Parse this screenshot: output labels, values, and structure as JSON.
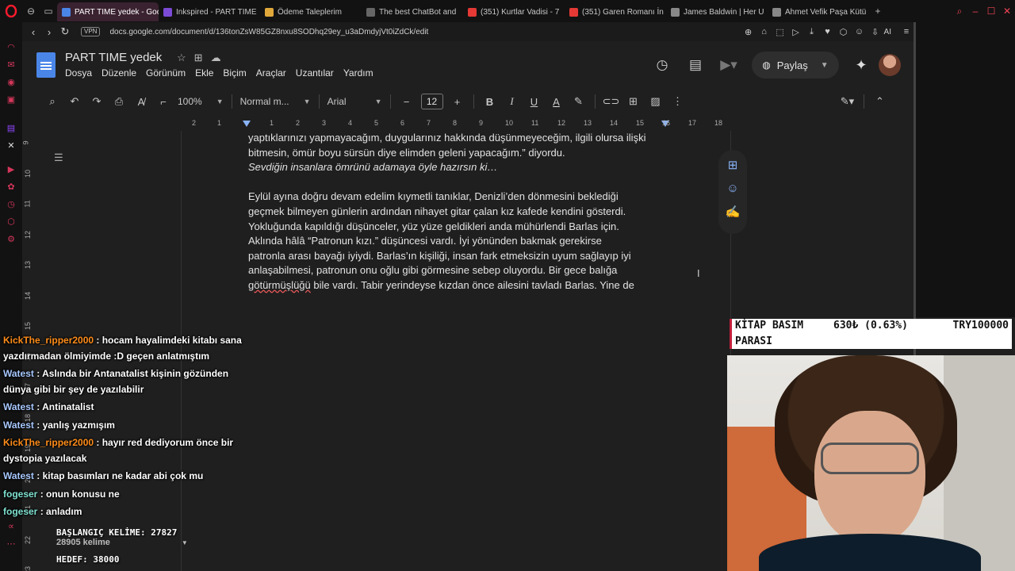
{
  "browser": {
    "tabs": [
      {
        "label": "PART TIME yedek - Googl",
        "active": true,
        "fav_color": "#4a86e8"
      },
      {
        "label": "Inkspired - PART TIME",
        "active": false,
        "fav_color": "#7b4bd6"
      },
      {
        "label": "Ödeme Taleplerim",
        "active": false,
        "fav_color": "#e0a83a"
      },
      {
        "label": "The best ChatBot and",
        "active": false,
        "fav_color": "#666666"
      },
      {
        "label": "(351) Kurtlar Vadisi - 7",
        "active": false,
        "fav_color": "#e53935"
      },
      {
        "label": "(351) Garen Romanı İn",
        "active": false,
        "fav_color": "#e53935"
      },
      {
        "label": "James Baldwin | Her U",
        "active": false,
        "fav_color": "#888888"
      },
      {
        "label": "Ahmet Vefik Paşa Kütü",
        "active": false,
        "fav_color": "#888888"
      }
    ],
    "new_tab": "+",
    "vpn_label": "VPN",
    "url": "docs.google.com/document/d/136tonZsW85GZ8nxu8SODhq29ey_u3aDmdyjVt0iZdCk/edit",
    "ai_label": "AI"
  },
  "docs": {
    "title": "PART TIME  yedek",
    "menu": [
      "Dosya",
      "Düzenle",
      "Görünüm",
      "Ekle",
      "Biçim",
      "Araçlar",
      "Uzantılar",
      "Yardım"
    ],
    "share_label": "Paylaş",
    "zoom": "100%",
    "style": "Normal m...",
    "font": "Arial",
    "font_size": "12",
    "ruler_numbers": [
      "2",
      "1",
      "1",
      "2",
      "3",
      "4",
      "5",
      "6",
      "7",
      "8",
      "9",
      "10",
      "11",
      "12",
      "13",
      "14",
      "15",
      "16",
      "17",
      "18"
    ],
    "vruler_numbers": [
      "9",
      "10",
      "11",
      "12",
      "13",
      "14",
      "15",
      "16",
      "17",
      "18",
      "19",
      "20",
      "21",
      "22",
      "23"
    ]
  },
  "document": {
    "partial_line": "yaptıklarınızı yapmayacağım, duygularınız hakkında düşünmeyeceğim, ilgili olursa ilişki",
    "line1": "bitmesin, ömür boyu sürsün diye elimden geleni yapacağım.” diyordu.",
    "line2": "Sevdiğin insanlara ömrünü adamaya öyle hazırsın ki…",
    "para2_l1": "Eylül ayına doğru devam edelim kıymetli tanıklar, Denizli’den dönmesini beklediği",
    "para2_l2": "geçmek bilmeyen günlerin ardından nihayet gitar çalan kız kafede kendini gösterdi.",
    "para2_l3": "Yokluğunda kapıldığı düşünceler, yüz yüze geldikleri anda mühürlendi Barlas için.",
    "para2_l4": "Aklında hâlâ “Patronun kızı.” düşüncesi vardı. İyi yönünden bakmak gerekirse",
    "para2_l5": "patronla arası bayağı iyiydi. Barlas’ın kişiliği, insan fark etmeksizin uyum sağlayıp iyi",
    "para2_l6": "anlaşabilmesi, patronun onu oğlu gibi görmesine sebep oluyordu. Bir gece balığa",
    "para2_l7_a": "götürmüşlüğü",
    "para2_l7_b": " bile vardı. Tabir yerindeyse kızdan önce ailesini tavladı Barlas. Yine de"
  },
  "ticker": {
    "label_line1": "KİTAP BASIM",
    "label_line2": "PARASI",
    "value": "630₺ (0.63%)",
    "goal": "TRY100000"
  },
  "chat": [
    {
      "user": "KickThe_ripper2000",
      "text": " : hocam hayalimdeki kitabı sana yazdırmadan ölmiyimde :D geçen anlatmıştım",
      "cls": "u-kick"
    },
    {
      "user": "Watest",
      "text": " : Aslında bir Antanatalist kişinin gözünden dünya gibi bir şey de yazılabilir",
      "cls": "u-watest"
    },
    {
      "user": "Watest",
      "text": " : Antinatalist",
      "cls": "u-watest"
    },
    {
      "user": "Watest",
      "text": " : yanlış yazmışım",
      "cls": "u-watest"
    },
    {
      "user": "KickThe_ripper2000",
      "text": " : hayır red dediyorum önce bir dystopia yazılacak",
      "cls": "u-kick"
    },
    {
      "user": "Watest",
      "text": " : kitap basımları ne kadar abi çok mu",
      "cls": "u-watest"
    },
    {
      "user": "fogeser",
      "text": " : onun konusu ne",
      "cls": "u-fog"
    },
    {
      "user": "fogeser",
      "text": " : anladım",
      "cls": "u-fog"
    }
  ],
  "counter": {
    "start": "BAŞLANGIÇ KELİME: 27827",
    "words": "28905 kelime",
    "goal": "HEDEF: 38000"
  }
}
